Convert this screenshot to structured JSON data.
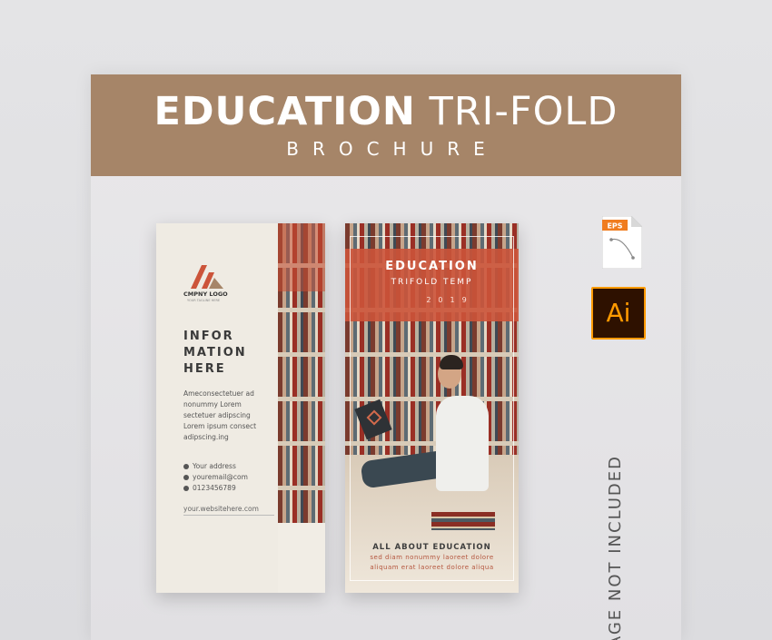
{
  "banner": {
    "title_bold": "EDUCATION",
    "title_light": " TRI-FOLD",
    "subtitle": "BROCHURE"
  },
  "left_panel": {
    "logo_name": "CMPNY LOGO",
    "logo_tagline": "YOUR TAGLINE HERE",
    "heading_lines": [
      "INFOR",
      "MATION",
      "HERE"
    ],
    "body_lines": [
      "Ameconsectetuer ad",
      "nonummy Lorem",
      "sectetuer adipscing",
      "Lorem ipsum consect",
      "adipscing.ing"
    ],
    "contacts": [
      "Your address",
      "youremail@com",
      "0123456789"
    ],
    "website": "your.websitehere.com"
  },
  "right_panel": {
    "title": "EDUCATION",
    "subtitle": "TRIFOLD TEMP",
    "year": "2019",
    "bottom_title": "ALL ABOUT EDUCATION",
    "bottom_lines": [
      "sed diam nonummy laoreet dolore",
      "aliquam erat laoreet dolore aliqua"
    ]
  },
  "icons": {
    "eps_label": "EPS",
    "ai_label": "Ai",
    "accent": "#ff9a00"
  },
  "side_note": "IMAGE NOT INCLUDED",
  "colors": {
    "banner": "#a68568",
    "brochure_accent": "#cc543a"
  }
}
